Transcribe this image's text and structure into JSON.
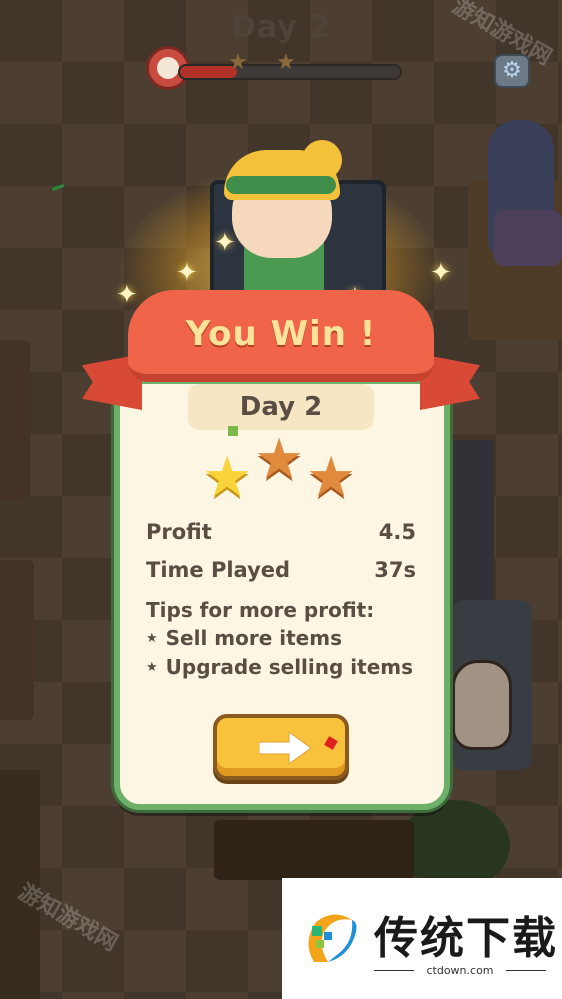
{
  "hud": {
    "day_title": "Day 2",
    "time_progress": 0.26,
    "milestone_stars": 2
  },
  "result": {
    "banner": "You Win !",
    "day_label": "Day 2",
    "stars_earned": 1,
    "stars_total": 3,
    "profit_label": "Profit",
    "profit_value": "4.5",
    "time_label": "Time Played",
    "time_value": "37s",
    "tips_title": "Tips for more profit:",
    "tips": [
      "Sell more items",
      "Upgrade selling items"
    ],
    "next_button_icon": "arrow-right-icon"
  },
  "icons": {
    "clock": "alarm-clock-icon",
    "settings": "gear-icon",
    "star_full": "★",
    "star_empty": "★"
  },
  "watermark": "游知游戏网",
  "brand": {
    "title": "传统下载",
    "domain": "ctdown.com"
  },
  "colors": {
    "panel_bg": "#fdf6e3",
    "panel_border": "#6db06a",
    "ribbon": "#f0654a",
    "button": "#f8c23a",
    "star_full": "#f8d43a",
    "star_empty": "#e08a3e"
  }
}
